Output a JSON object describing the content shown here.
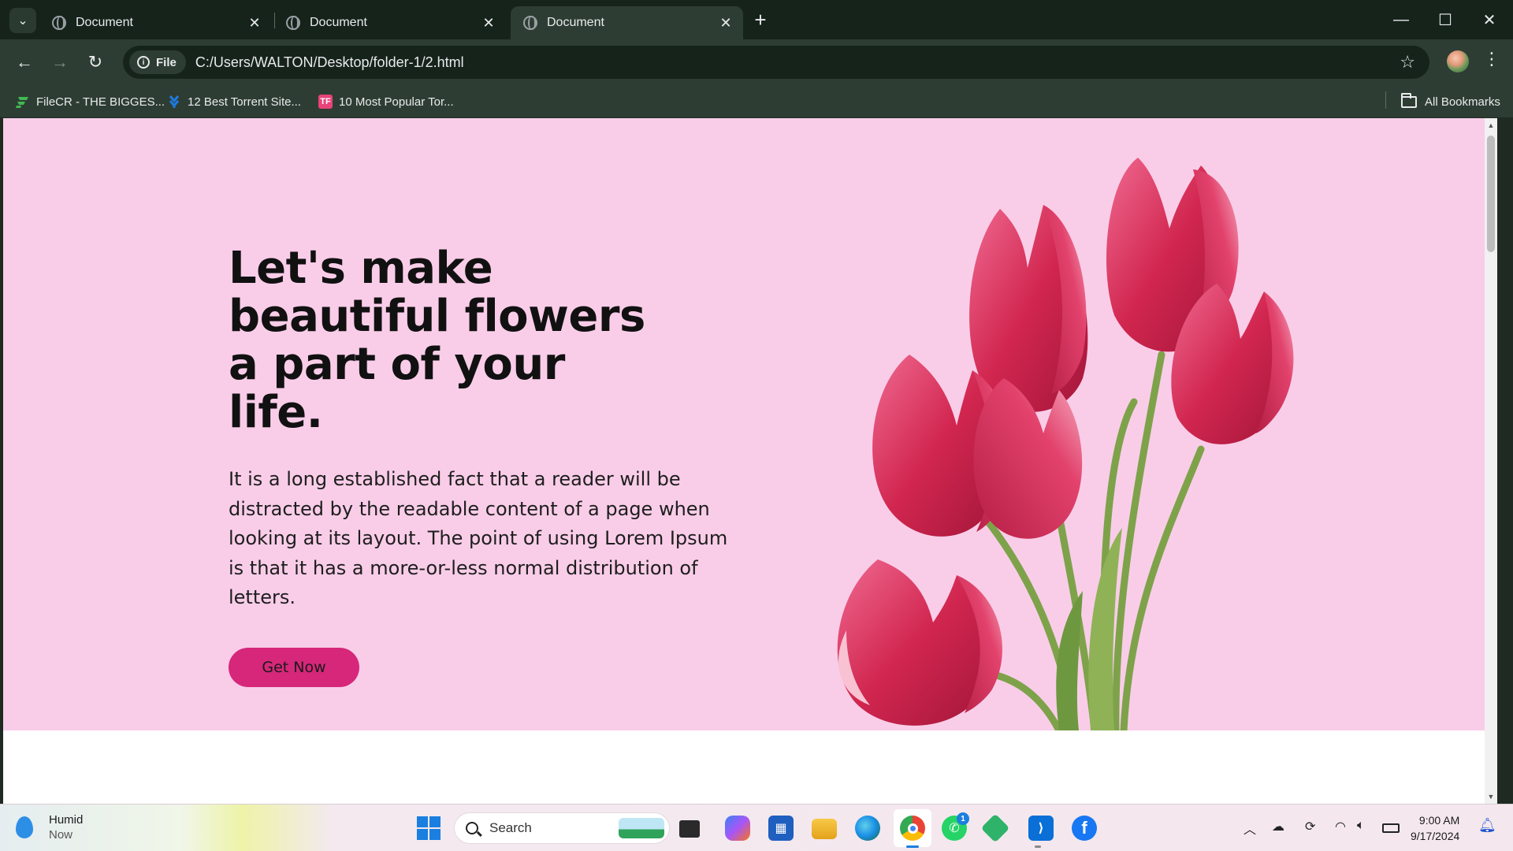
{
  "browser": {
    "tabs": [
      {
        "title": "Document",
        "active": false
      },
      {
        "title": "Document",
        "active": false
      },
      {
        "title": "Document",
        "active": true
      }
    ],
    "address": {
      "scheme_chip": "File",
      "url": "C:/Users/WALTON/Desktop/folder-1/2.html"
    },
    "bookmarks": [
      {
        "label": "FileCR - THE BIGGES...",
        "icon": "filecr-icon",
        "color": "#3fb950"
      },
      {
        "label": "12 Best Torrent Site...",
        "icon": "torrent-icon",
        "color": "#1f7ae0"
      },
      {
        "label": "10 Most Popular Tor...",
        "icon": "tf-icon",
        "icon_text": "TF",
        "color": "#e8437a"
      }
    ],
    "all_bookmarks_label": "All Bookmarks"
  },
  "page": {
    "hero": {
      "title": "Let's make beautiful flowers a part of your life.",
      "body": "It is a long established fact that a reader will be distracted by the readable content of a page when looking at its layout. The point of using Lorem Ipsum is that it has a more-or-less normal distribution of letters.",
      "cta_label": "Get Now",
      "background_color": "#f9cde8",
      "cta_color": "#d6277a",
      "image": "tulip-bouquet"
    }
  },
  "taskbar": {
    "weather": {
      "condition": "Humid",
      "time": "Now"
    },
    "search_placeholder": "Search",
    "pinned": [
      "windows-start-icon",
      "search",
      "task-view-icon",
      "copilot-icon",
      "store-icon",
      "file-explorer-icon",
      "edge-icon",
      "chrome-icon",
      "whatsapp-icon",
      "app-icon",
      "vscode-icon",
      "facebook-icon"
    ],
    "whatsapp_badge": "1",
    "clock": {
      "time": "9:00 AM",
      "date": "9/17/2024"
    }
  }
}
